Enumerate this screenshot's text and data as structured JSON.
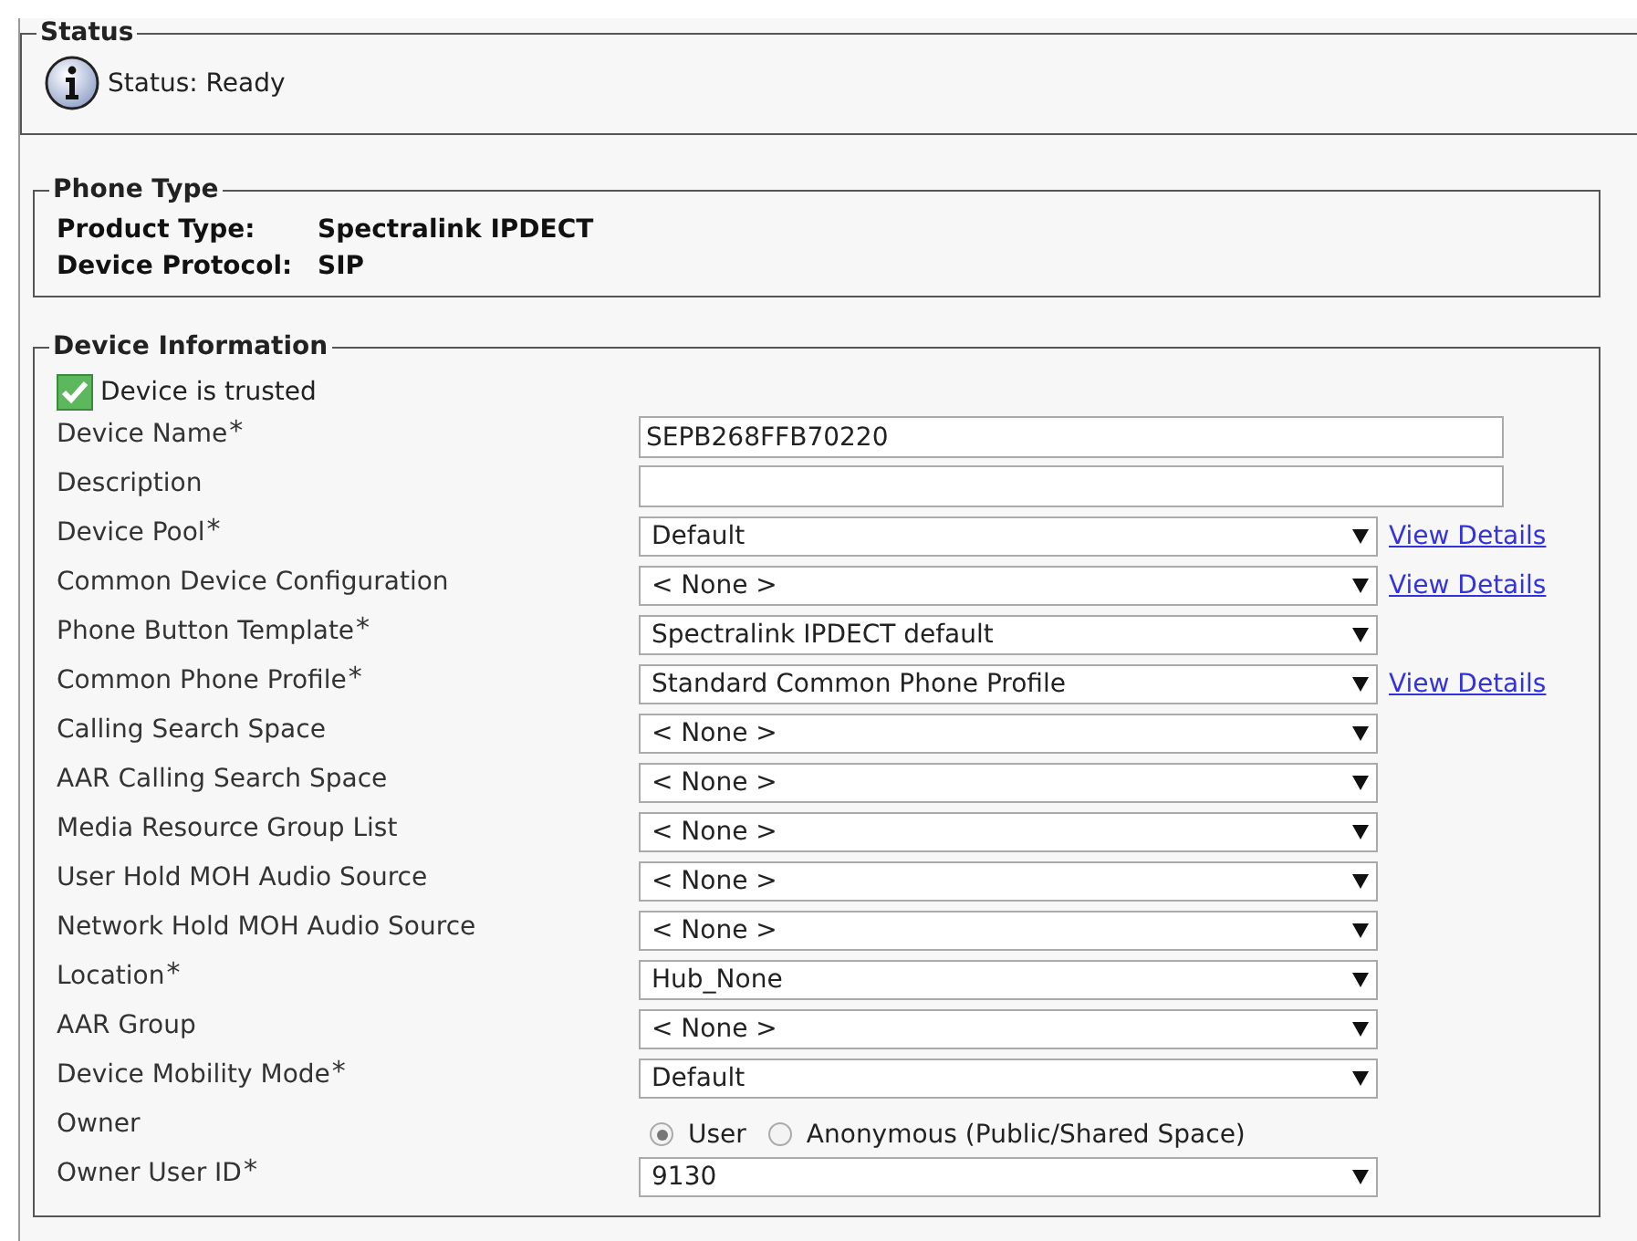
{
  "status": {
    "legend": "Status",
    "message": "Status: Ready"
  },
  "phone_type": {
    "legend": "Phone Type",
    "items": [
      {
        "label": "Product Type:",
        "value": "Spectralink IPDECT"
      },
      {
        "label": "Device Protocol:",
        "value": "SIP"
      }
    ]
  },
  "device_information": {
    "legend": "Device Information",
    "trusted": {
      "label": "Device is trusted",
      "checked": true
    },
    "rows": [
      {
        "kind": "text",
        "label": "Device Name",
        "required": "*",
        "value": "SEPB268FFB70220"
      },
      {
        "kind": "text",
        "label": "Description"
      },
      {
        "kind": "select",
        "label": "Device Pool",
        "required": "*",
        "value": "Default",
        "link": "View Details"
      },
      {
        "kind": "select",
        "label": "Common Device Configuration",
        "value": "< None >",
        "link": "View Details"
      },
      {
        "kind": "select",
        "label": "Phone Button Template",
        "required": "*",
        "value": "Spectralink IPDECT default"
      },
      {
        "kind": "select",
        "label": "Common Phone Profile",
        "required": "*",
        "value": "Standard Common Phone Profile",
        "link": "View Details"
      },
      {
        "kind": "select",
        "label": "Calling Search Space",
        "value": "< None >"
      },
      {
        "kind": "select",
        "label": "AAR Calling Search Space",
        "value": "< None >"
      },
      {
        "kind": "select",
        "label": "Media Resource Group List",
        "value": "< None >"
      },
      {
        "kind": "select",
        "label": "User Hold MOH Audio Source",
        "value": "< None >"
      },
      {
        "kind": "select",
        "label": "Network Hold MOH Audio Source",
        "value": "< None >"
      },
      {
        "kind": "select",
        "label": "Location",
        "required": "*",
        "value": "Hub_None"
      },
      {
        "kind": "select",
        "label": "AAR Group",
        "value": "< None >"
      },
      {
        "kind": "select",
        "label": "Device Mobility Mode",
        "required": "*",
        "value": "Default"
      },
      {
        "kind": "radio",
        "label": "Owner",
        "options": [
          {
            "label": "User",
            "selected": true
          },
          {
            "label": "Anonymous (Public/Shared Space)",
            "selected": false
          }
        ]
      },
      {
        "kind": "select",
        "label": "Owner User ID",
        "required": "*",
        "value": "9130"
      }
    ]
  }
}
